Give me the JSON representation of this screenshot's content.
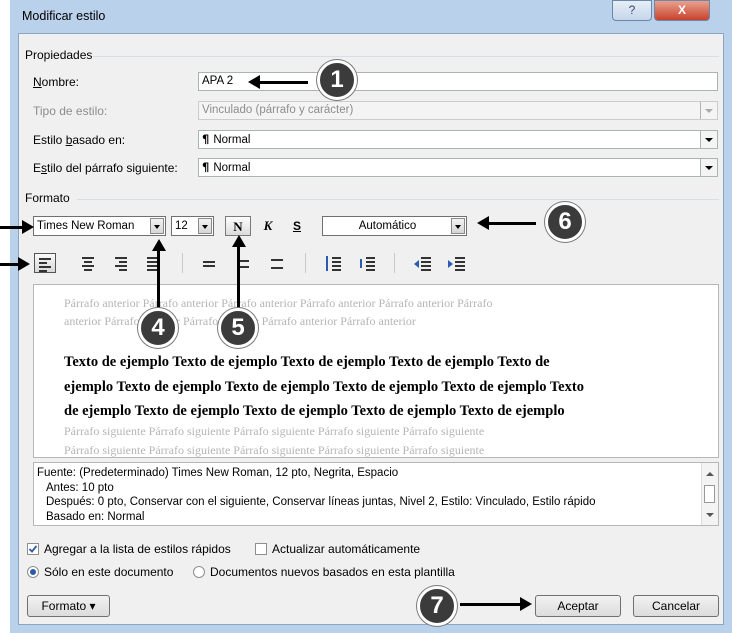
{
  "window": {
    "title": "Modificar estilo",
    "help_glyph": "?",
    "close_glyph": "X"
  },
  "properties": {
    "group_label": "Propiedades",
    "name_label": "Nombre:",
    "name_value": "APA 2",
    "type_label": "Tipo de estilo:",
    "type_value": "Vinculado (párrafo y carácter)",
    "based_label": "Estilo basado en:",
    "based_value": "Normal",
    "next_label": "Estilo del párrafo siguiente:",
    "next_value": "Normal"
  },
  "format": {
    "group_label": "Formato",
    "font": "Times New Roman",
    "size": "12",
    "bold_glyph": "N",
    "italic_glyph": "K",
    "underline_glyph": "S",
    "color": "Automático"
  },
  "preview": {
    "prev_line1": "Párrafo anterior Párrafo anterior Párrafo anterior Párrafo anterior Párrafo anterior Párrafo",
    "prev_line2": "anterior Párrafo anterior Párrafo anterior Párrafo anterior Párrafo anterior",
    "sample_line1": "Texto de ejemplo Texto de ejemplo Texto de ejemplo Texto de ejemplo Texto de",
    "sample_line2": "ejemplo Texto de ejemplo Texto de ejemplo Texto de ejemplo Texto de ejemplo Texto",
    "sample_line3": "de ejemplo Texto de ejemplo Texto de ejemplo Texto de ejemplo Texto de ejemplo",
    "next_line1": "Párrafo siguiente Párrafo siguiente Párrafo siguiente Párrafo siguiente Párrafo siguiente",
    "next_line2": "Párrafo siguiente Párrafo siguiente Párrafo siguiente Párrafo siguiente Párrafo siguiente"
  },
  "description": {
    "line1": "Fuente: (Predeterminado) Times New Roman, 12 pto, Negrita, Espacio",
    "line2": "Antes:  10 pto",
    "line3": "Después:  0 pto, Conservar con el siguiente, Conservar líneas juntas, Nivel 2, Estilo: Vinculado, Estilo rápido",
    "line4": "Basado en: Normal"
  },
  "options": {
    "add_quick": "Agregar a la lista de estilos rápidos",
    "add_quick_checked": true,
    "auto_update": "Actualizar automáticamente",
    "auto_update_checked": false,
    "only_doc": "Sólo en este documento",
    "new_docs": "Documentos nuevos basados en esta plantilla",
    "selected_scope": "Sólo en este documento"
  },
  "buttons": {
    "format": "Formato",
    "format_arrow": "▾",
    "accept": "Aceptar",
    "cancel": "Cancelar"
  },
  "callouts": [
    "1",
    "4",
    "5",
    "6",
    "7"
  ],
  "colors": {
    "frame": "#b9d1ea",
    "panel": "#f0f0f0",
    "callout": "#3b3b3b"
  },
  "icons": [
    "align-left-icon",
    "align-center-icon",
    "align-right-icon",
    "justify-icon",
    "single-spacing-icon",
    "one-half-spacing-icon",
    "double-spacing-icon",
    "increase-spacing-icon",
    "decrease-spacing-icon",
    "decrease-indent-icon",
    "increase-indent-icon"
  ]
}
